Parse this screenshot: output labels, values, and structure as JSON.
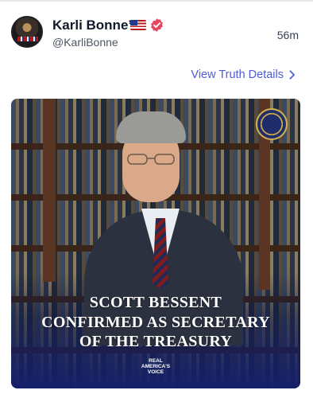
{
  "post": {
    "display_name": "Karli Bonne’",
    "handle": "@KarliBonne",
    "time": "56m",
    "view_details_label": "View Truth Details",
    "icons": {
      "flag": "us-flag-icon",
      "verified": "verified-badge-icon",
      "chevron": "chevron-right-icon"
    },
    "colors": {
      "link": "#4f5bd5",
      "verified": "#e8455e"
    }
  },
  "media": {
    "headline_lines": [
      "SCOTT BESSENT",
      "CONFIRMED AS SECRETARY",
      "OF THE TREASURY"
    ],
    "logo_lines": [
      "REAL",
      "AMERICA'S",
      "VOICE"
    ]
  }
}
